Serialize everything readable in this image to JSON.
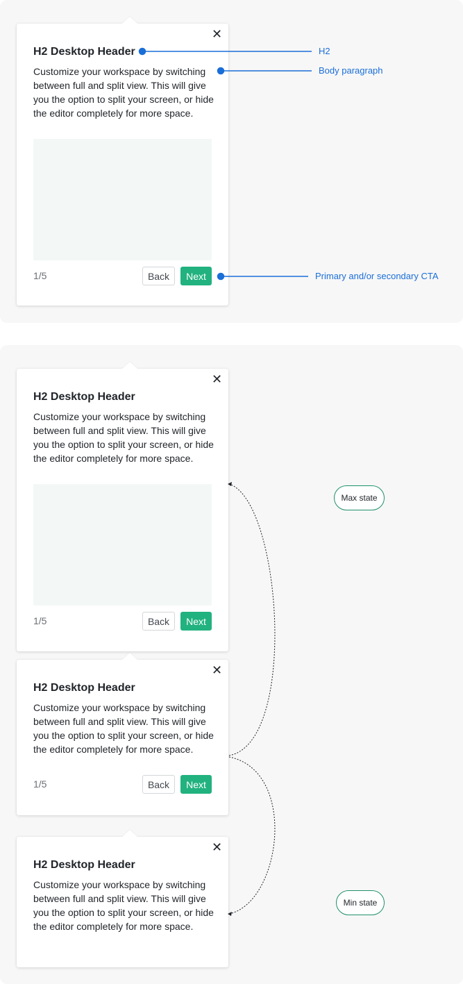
{
  "card": {
    "title": "H2 Desktop Header",
    "body": "Customize your workspace by switching between full and split view. This will give you the option to split your screen, or hide the editor completely for more space.",
    "counter": "1/5",
    "back_label": "Back",
    "next_label": "Next",
    "close_glyph": "✕",
    "close_icon": "close-icon"
  },
  "annotations": {
    "h2": "H2",
    "body": "Body paragraph",
    "cta": "Primary and/or secondary CTA"
  },
  "states": {
    "max": "Max state",
    "min": "Min state"
  },
  "colors": {
    "accent": "#21b27f",
    "annotation": "#1a6ed8",
    "media_placeholder": "#f3f8f6",
    "panel_bg": "#f7f7f7"
  }
}
